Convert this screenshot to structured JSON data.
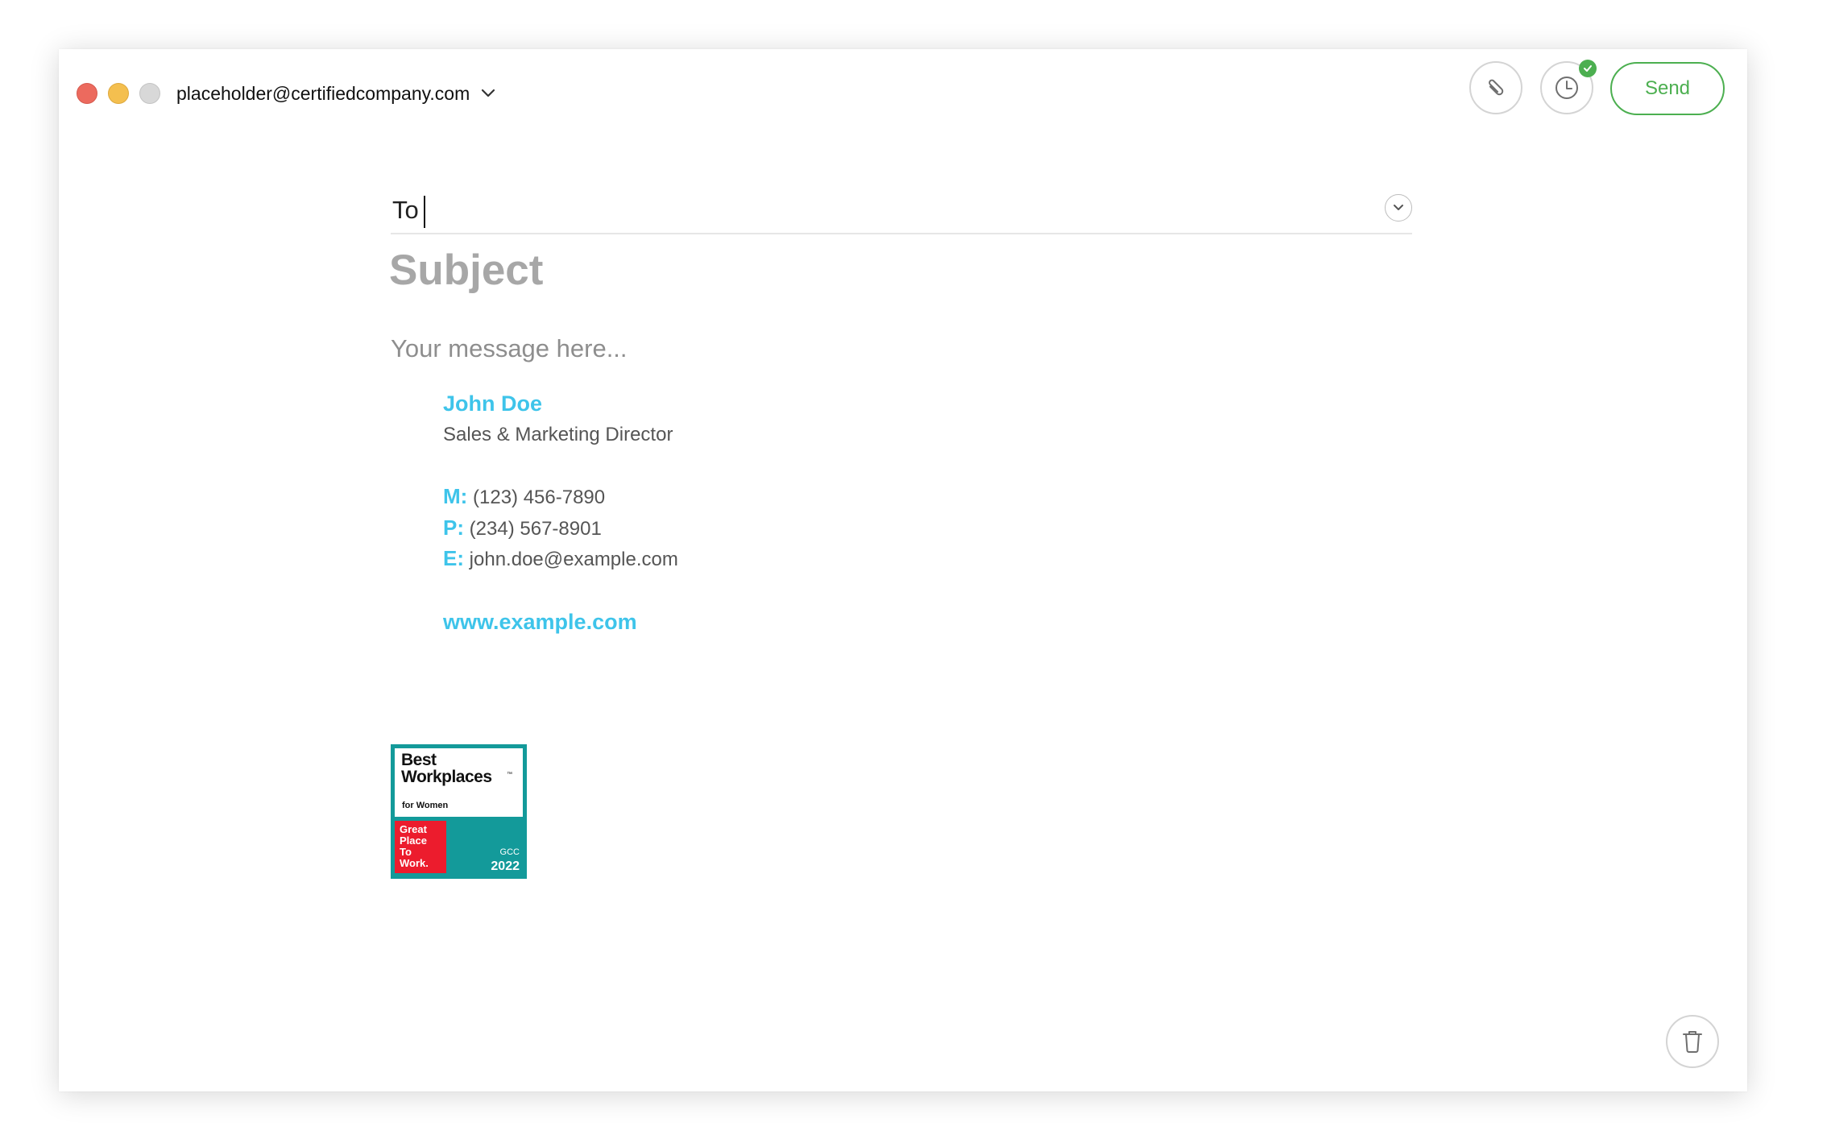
{
  "header": {
    "account_email": "placeholder@certifiedcompany.com",
    "send_label": "Send",
    "schedule_status": "check-badge"
  },
  "compose": {
    "to_label": "To",
    "to_value": "",
    "subject_placeholder": "Subject",
    "message_placeholder": "Your message here..."
  },
  "signature": {
    "name": "John Doe",
    "title": "Sales & Marketing Director",
    "mobile_label": "M:",
    "mobile": "(123) 456-7890",
    "phone_label": "P:",
    "phone": "(234) 567-8901",
    "email_label": "E:",
    "email": "john.doe@example.com",
    "website": "www.example.com"
  },
  "badge": {
    "line1": "Best",
    "line2": "Workplaces",
    "subtitle": "for Women",
    "gptw": [
      "Great",
      "Place",
      "To",
      "Work."
    ],
    "region": "GCC",
    "year": "2022"
  },
  "colors": {
    "accent_green": "#4caf50",
    "signature_blue": "#3ec4ea",
    "badge_teal": "#139a9a",
    "badge_red": "#ec1c2d",
    "traffic_red": "#ec6a5e",
    "traffic_yellow": "#f4bf4f",
    "traffic_gray": "#d8d8d8"
  },
  "icons": {
    "attach": "paperclip-icon",
    "schedule": "clock-icon",
    "expand": "chevron-down-icon",
    "delete": "trash-icon"
  }
}
